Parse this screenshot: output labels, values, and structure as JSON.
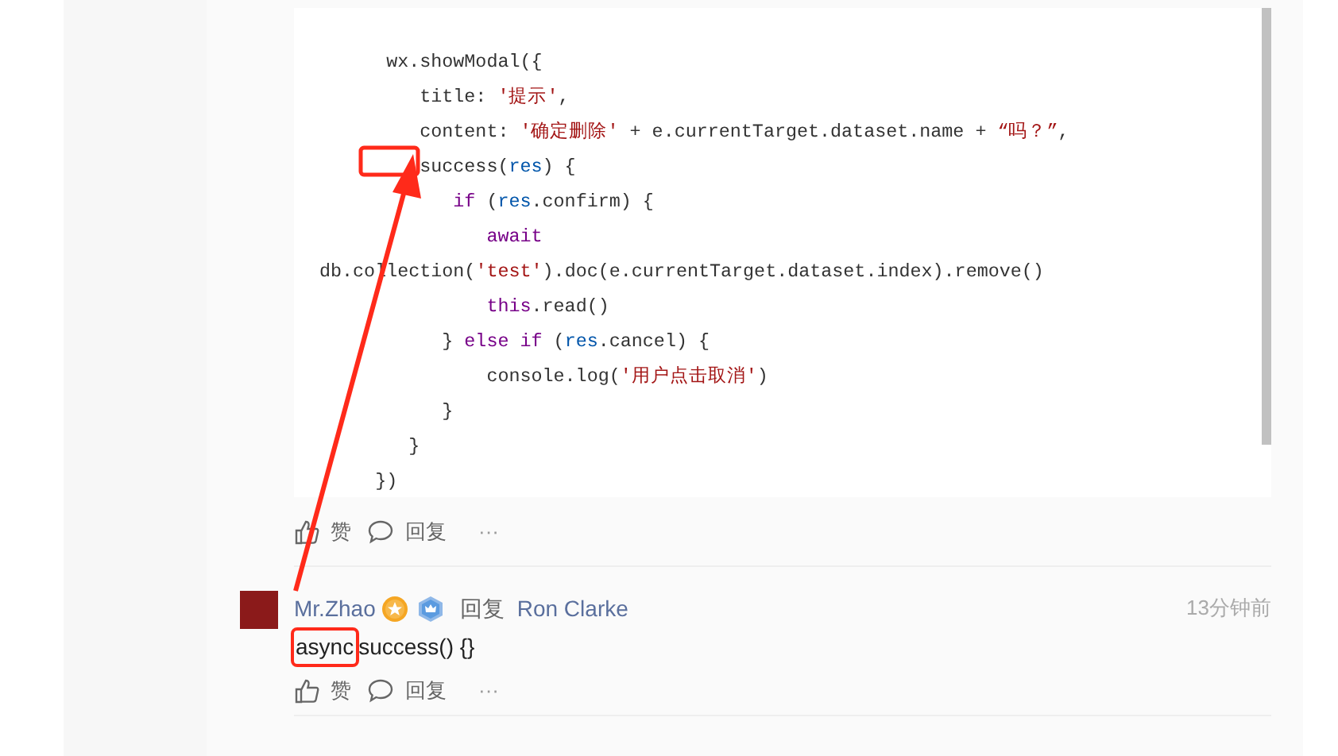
{
  "code_block": {
    "lines": [
      {
        "tokens": [
          {
            "kind": "plain",
            "text": "      wx.showModal({"
          }
        ]
      },
      {
        "tokens": [
          {
            "kind": "plain",
            "text": "         title: "
          },
          {
            "kind": "string",
            "text": "'提示'"
          },
          {
            "kind": "plain",
            "text": ","
          }
        ]
      },
      {
        "tokens": [
          {
            "kind": "plain",
            "text": "         content: "
          },
          {
            "kind": "string",
            "text": "'确定删除'"
          },
          {
            "kind": "plain",
            "text": " + e.currentTarget.dataset.name + "
          },
          {
            "kind": "string",
            "text": "“吗？”"
          },
          {
            "kind": "plain",
            "text": ","
          }
        ]
      },
      {
        "tokens": [
          {
            "kind": "plain",
            "text": "         success("
          },
          {
            "kind": "variable",
            "text": "res"
          },
          {
            "kind": "plain",
            "text": ") {"
          }
        ]
      },
      {
        "tokens": [
          {
            "kind": "keyword",
            "text": "            if"
          },
          {
            "kind": "plain",
            "text": " ("
          },
          {
            "kind": "variable",
            "text": "res"
          },
          {
            "kind": "plain",
            "text": ".confirm) {"
          }
        ]
      },
      {
        "tokens": [
          {
            "kind": "keyword",
            "text": "               await"
          }
        ]
      },
      {
        "tokens": [
          {
            "kind": "plain",
            "text": "db.collection("
          },
          {
            "kind": "string",
            "text": "'test'"
          },
          {
            "kind": "plain",
            "text": ").doc(e.currentTarget.dataset.index).remove()"
          }
        ]
      },
      {
        "tokens": [
          {
            "kind": "keyword",
            "text": "               this"
          },
          {
            "kind": "plain",
            "text": ".read()"
          }
        ]
      },
      {
        "tokens": [
          {
            "kind": "plain",
            "text": "           } "
          },
          {
            "kind": "keyword",
            "text": "else if"
          },
          {
            "kind": "plain",
            "text": " ("
          },
          {
            "kind": "variable",
            "text": "res"
          },
          {
            "kind": "plain",
            "text": ".cancel) {"
          }
        ]
      },
      {
        "tokens": [
          {
            "kind": "plain",
            "text": "               console.log("
          },
          {
            "kind": "string",
            "text": "'用户点击取消'"
          },
          {
            "kind": "plain",
            "text": ")"
          }
        ]
      },
      {
        "tokens": [
          {
            "kind": "plain",
            "text": "           }"
          }
        ]
      },
      {
        "tokens": [
          {
            "kind": "plain",
            "text": "        }"
          }
        ]
      },
      {
        "tokens": [
          {
            "kind": "plain",
            "text": "     })"
          }
        ]
      }
    ]
  },
  "post_actions": [
    {
      "kind": "like",
      "label": "赞"
    },
    {
      "kind": "reply",
      "label": "回复"
    },
    {
      "kind": "more",
      "label": "···"
    }
  ],
  "comment": {
    "author": "Mr.Zhao",
    "badges": [
      {
        "kind": "star"
      },
      {
        "kind": "crown"
      }
    ],
    "reply_label": "回复",
    "reply_to": "Ron Clarke",
    "time": "13分钟前",
    "body": [
      {
        "text": "async",
        "highlighted": true
      },
      {
        "text": "success() {}",
        "highlighted": false
      }
    ],
    "actions": [
      {
        "kind": "like",
        "label": "赞"
      },
      {
        "kind": "reply",
        "label": "回复"
      },
      {
        "kind": "more",
        "label": "···"
      }
    ]
  }
}
